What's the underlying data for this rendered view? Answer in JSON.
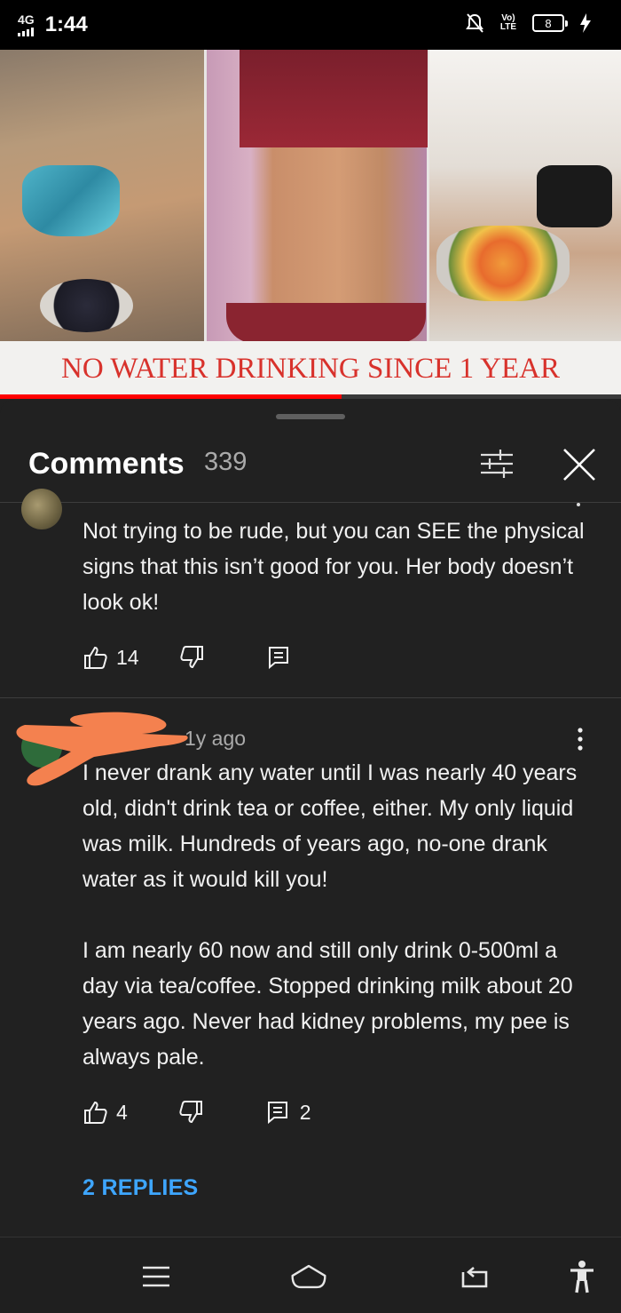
{
  "status_bar": {
    "network": "4G",
    "time": "1:44",
    "lte": "LTE",
    "battery": "8"
  },
  "video": {
    "banner_text": "NO WATER DRINKING SINCE 1 YEAR",
    "progress": 0.55,
    "progress_color": "#ff0000"
  },
  "comments_panel": {
    "title": "Comments",
    "count": "339"
  },
  "comments": [
    {
      "text": "Not trying to be rude, but you can SEE the physical signs that this isn’t good for you. Her body doesn’t look ok!",
      "likes": "14",
      "replies_count": ""
    },
    {
      "time": "1y ago",
      "text_p1": "I never drank any water until I was nearly 40 years old, didn't drink tea or coffee, either. My only liquid was milk. Hundreds of years ago, no-one drank water as it would kill you!",
      "text_p2": "I am nearly 60 now and still only drink 0-500ml a day via tea/coffee. Stopped drinking milk about 20 years ago. Never had kidney problems, my pee is always pale.",
      "likes": "4",
      "replies_count": "2",
      "replies_link": "2 REPLIES"
    }
  ],
  "colors": {
    "background": "#212121",
    "link": "#3ea6ff",
    "redaction": "#f4814f"
  }
}
